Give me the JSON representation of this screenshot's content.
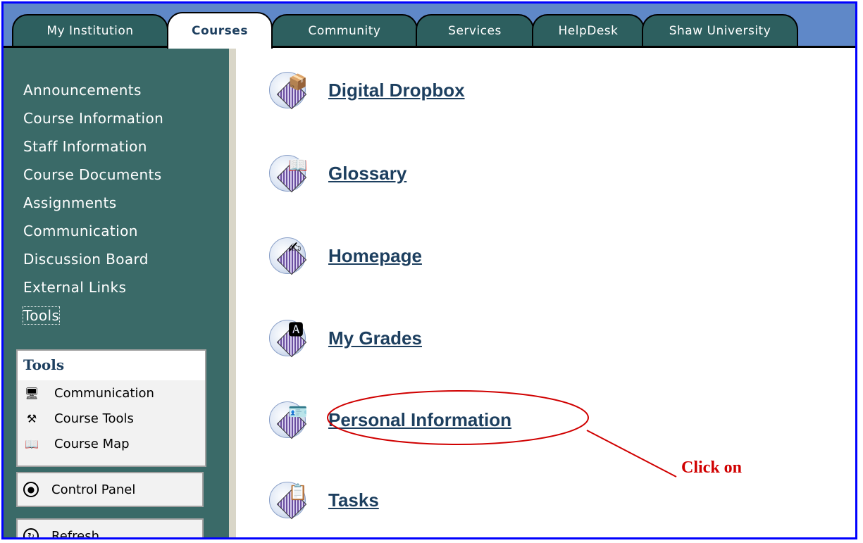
{
  "tabs": [
    {
      "label": "My Institution",
      "active": false
    },
    {
      "label": "Courses",
      "active": true
    },
    {
      "label": "Community",
      "active": false
    },
    {
      "label": "Services",
      "active": false
    },
    {
      "label": "HelpDesk",
      "active": false
    },
    {
      "label": "Shaw University",
      "active": false
    }
  ],
  "sidebar": {
    "nav": [
      "Announcements",
      "Course Information",
      "Staff Information",
      "Course Documents",
      "Assignments",
      "Communication",
      "Discussion Board",
      "External Links",
      "Tools"
    ],
    "focused_item": "Tools",
    "tools_box": {
      "title": "Tools",
      "items": [
        {
          "label": "Communication",
          "icon": "computer-icon"
        },
        {
          "label": "Course Tools",
          "icon": "tools-icon"
        },
        {
          "label": "Course Map",
          "icon": "map-book-icon"
        }
      ]
    },
    "control_panel": {
      "label": "Control Panel",
      "icon": "control-panel-icon"
    },
    "refresh": {
      "label": "Refresh",
      "icon": "refresh-icon"
    }
  },
  "main": {
    "items": [
      {
        "label": "Digital Dropbox",
        "icon": "dropbox-icon"
      },
      {
        "label": "Glossary",
        "icon": "glossary-book-icon"
      },
      {
        "label": "Homepage",
        "icon": "homepage-pen-icon"
      },
      {
        "label": "My Grades",
        "icon": "grades-icon"
      },
      {
        "label": "Personal Information",
        "icon": "id-card-icon"
      },
      {
        "label": "Tasks",
        "icon": "clipboard-icon"
      }
    ]
  },
  "annotation": {
    "text": "Click on",
    "color": "#d00000"
  },
  "colors": {
    "sidebar": "#3a6a68",
    "tab": "#2d5f5f",
    "tabbar": "#5f88c8",
    "link": "#1d3f5f",
    "frame": "#0000ff"
  }
}
